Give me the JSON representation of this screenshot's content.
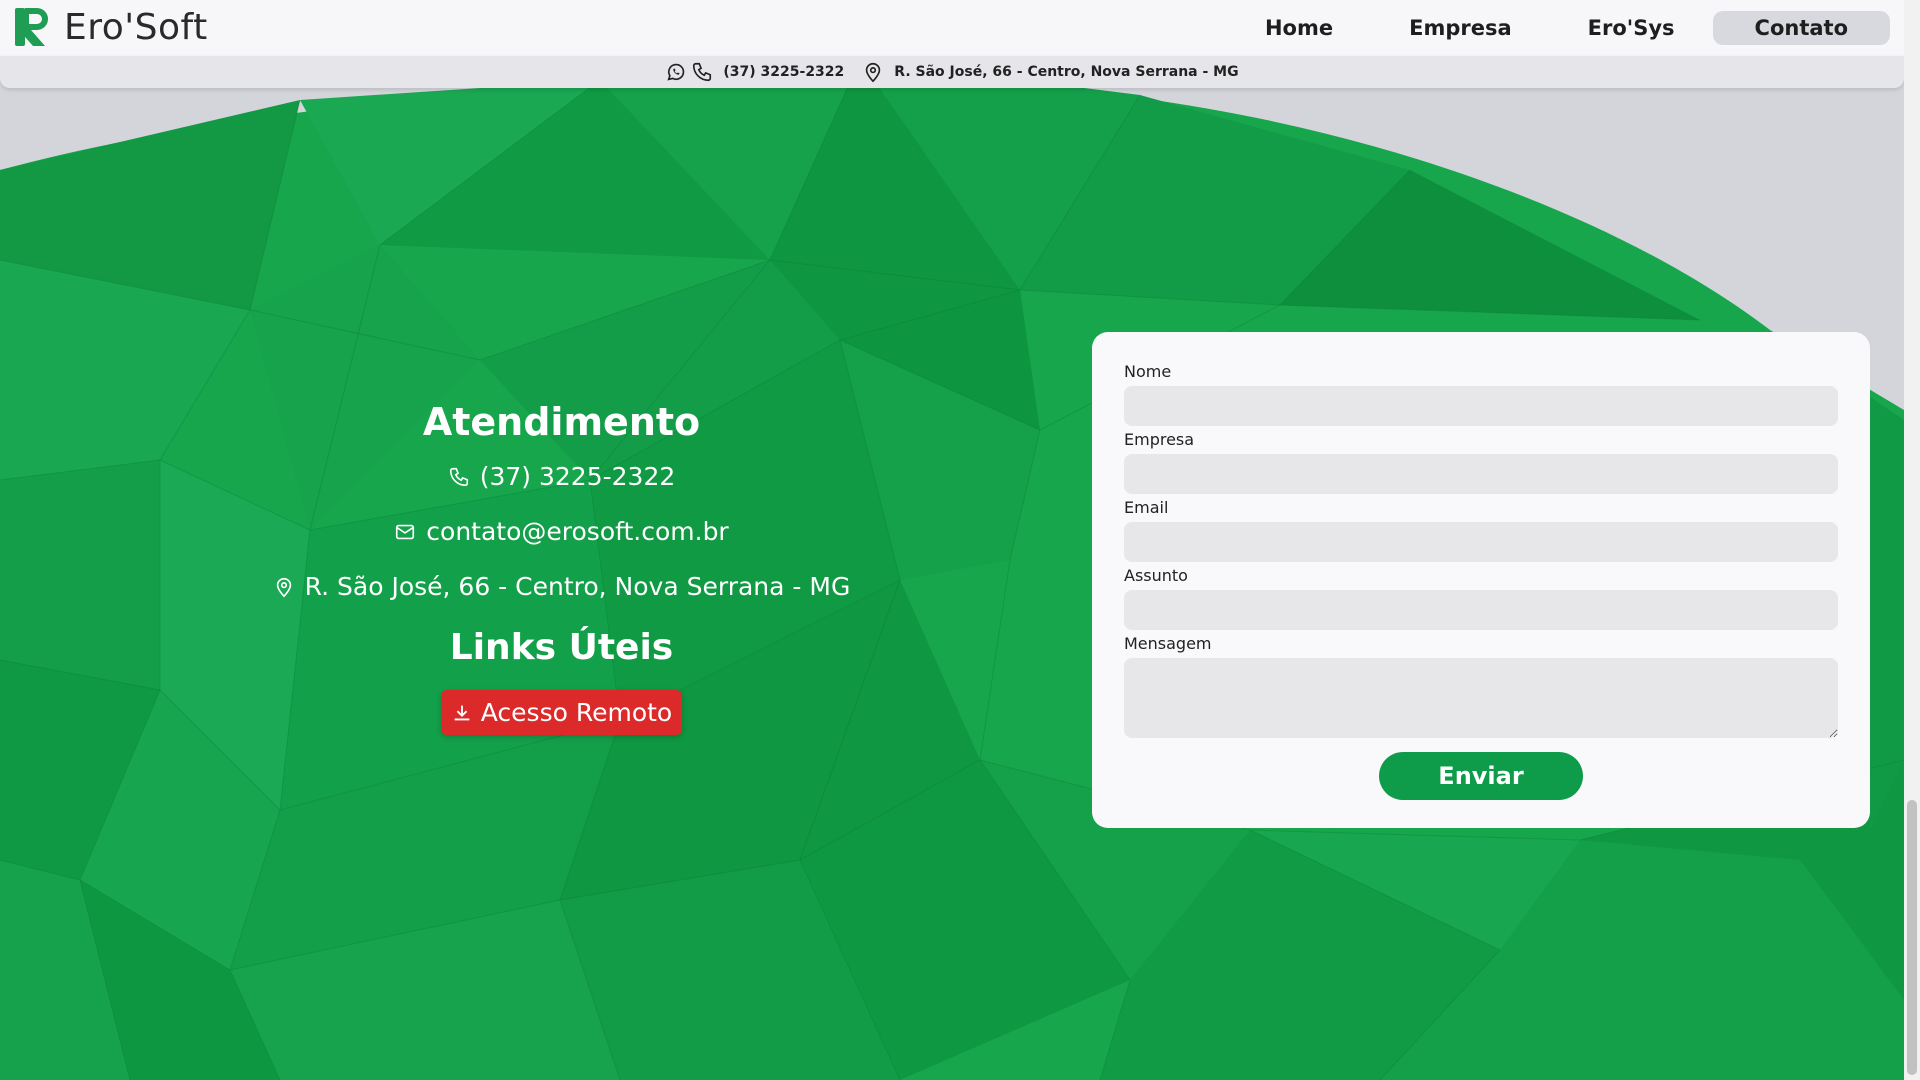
{
  "header": {
    "brand": "Ero'Soft",
    "nav": [
      {
        "label": "Home"
      },
      {
        "label": "Empresa"
      },
      {
        "label": "Ero'Sys"
      },
      {
        "label": "Contato",
        "active": true
      }
    ]
  },
  "infobar": {
    "phone": "(37) 3225-2322",
    "address": "R. São José, 66 - Centro, Nova Serrana - MG"
  },
  "contact": {
    "heading": "Atendimento",
    "phone": "(37) 3225-2322",
    "email": "contato@erosoft.com.br",
    "address": "R. São José, 66 - Centro, Nova Serrana - MG",
    "links_heading": "Links Úteis",
    "remote_button": "Acesso Remoto"
  },
  "form": {
    "fields": [
      {
        "label": "Nome",
        "value": ""
      },
      {
        "label": "Empresa",
        "value": ""
      },
      {
        "label": "Email",
        "value": ""
      },
      {
        "label": "Assunto",
        "value": ""
      },
      {
        "label": "Mensagem",
        "value": ""
      }
    ],
    "submit": "Enviar"
  },
  "colors": {
    "green": "#17a24b",
    "red": "#dc2a2a",
    "button_green": "#0e9b4a"
  }
}
